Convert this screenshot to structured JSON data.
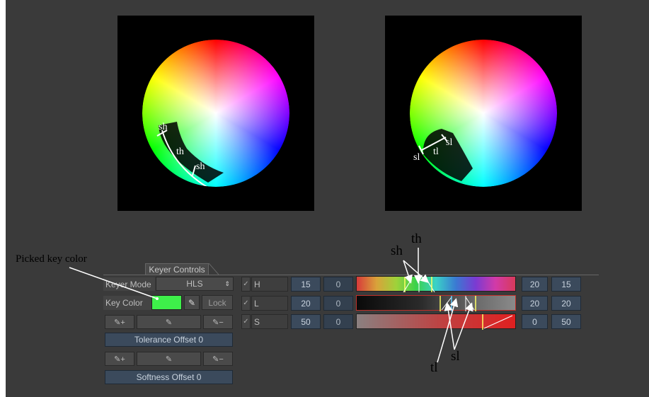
{
  "wheels": {
    "left": {
      "labels": [
        "sh",
        "th",
        "sh"
      ]
    },
    "right": {
      "labels": [
        "sl",
        "tl",
        "sl"
      ]
    }
  },
  "annotations": {
    "picked_key_color": "Picked key color",
    "sh": "sh",
    "th": "th",
    "tl": "tl",
    "sl": "sl"
  },
  "keyer": {
    "tab_label": "Keyer Controls",
    "mode_label": "Keyer Mode",
    "mode_value": "HLS",
    "key_color_label": "Key Color",
    "key_color_hex": "#3ef04a",
    "lock_label": "Lock",
    "tolerance_offset": "Tolerance Offset 0",
    "softness_offset": "Softness Offset 0"
  },
  "channels": [
    {
      "name": "H",
      "left_a": "15",
      "left_b": "0",
      "right_a": "20",
      "right_b": "15"
    },
    {
      "name": "L",
      "left_a": "20",
      "left_b": "0",
      "right_a": "20",
      "right_b": "20"
    },
    {
      "name": "S",
      "left_a": "50",
      "left_b": "0",
      "right_a": "0",
      "right_b": "50"
    }
  ],
  "icons": [
    "eyedropper-add-icon",
    "eyedropper-icon",
    "eyedropper-subtract-icon",
    "checkmark-icon",
    "spinner-arrows-icon"
  ]
}
